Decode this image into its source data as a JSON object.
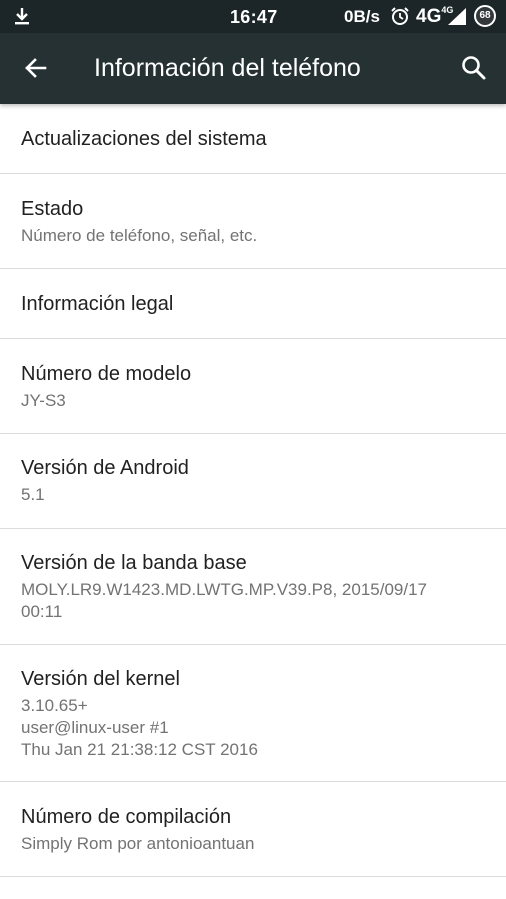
{
  "status_bar": {
    "time": "16:47",
    "speed": "0B/s",
    "network": "4G",
    "network_sup": "4G",
    "battery": "68",
    "icons": [
      "download-icon",
      "alarm-icon",
      "signal-icon",
      "battery-icon"
    ]
  },
  "toolbar": {
    "title": "Información del teléfono",
    "back_icon": "arrow-back-icon",
    "search_icon": "search-icon",
    "background": "#263134"
  },
  "items": [
    {
      "title": "Actualizaciones del sistema",
      "subtitle": ""
    },
    {
      "title": "Estado",
      "subtitle": "Número de teléfono, señal, etc."
    },
    {
      "title": "Información legal",
      "subtitle": ""
    },
    {
      "title": "Número de modelo",
      "subtitle": "JY-S3"
    },
    {
      "title": "Versión de Android",
      "subtitle": "5.1"
    },
    {
      "title": "Versión de la banda base",
      "subtitle": "MOLY.LR9.W1423.MD.LWTG.MP.V39.P8, 2015/09/17\n00:11"
    },
    {
      "title": "Versión del kernel",
      "subtitle": "3.10.65+\nuser@linux-user #1\nThu Jan 21 21:38:12 CST 2016"
    },
    {
      "title": "Número de compilación",
      "subtitle": "Simply Rom por antonioantuan"
    }
  ]
}
